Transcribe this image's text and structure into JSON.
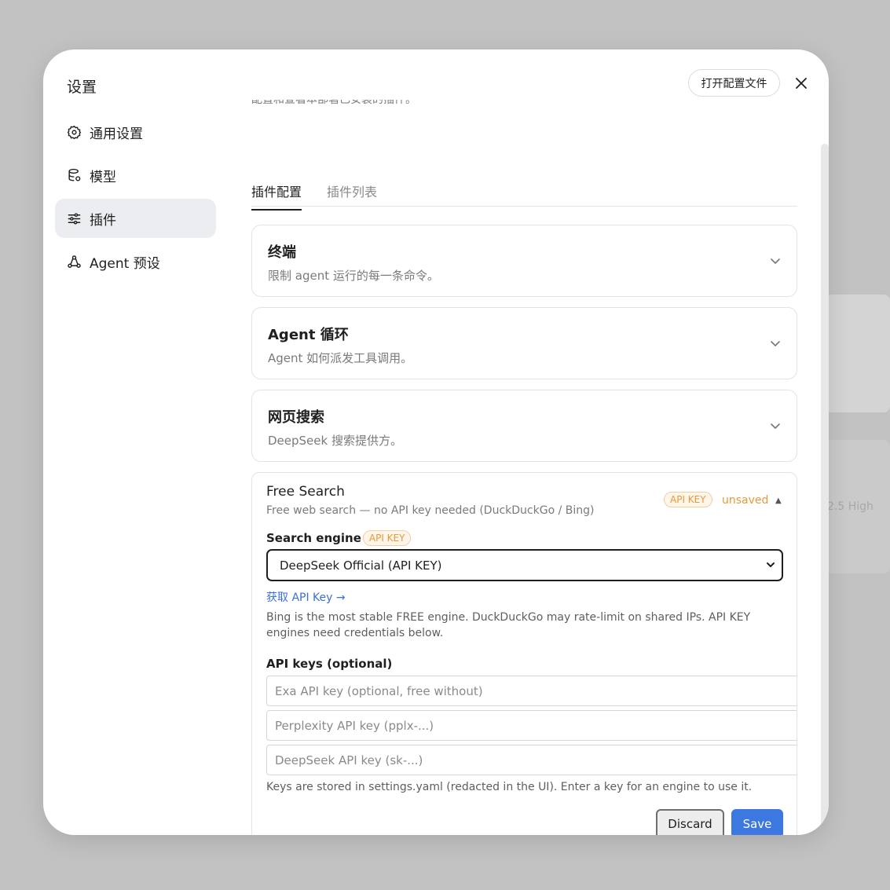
{
  "background": {
    "hint_text": "2.5 High"
  },
  "modal": {
    "title": "设置",
    "open_config_label": "打开配置文件",
    "close_icon": "close-icon"
  },
  "sidebar": {
    "items": [
      {
        "label": "通用设置",
        "icon": "gear-icon",
        "active": false
      },
      {
        "label": "模型",
        "icon": "database-icon",
        "active": false
      },
      {
        "label": "插件",
        "icon": "sliders-icon",
        "active": true
      },
      {
        "label": "Agent 预设",
        "icon": "agent-icon",
        "active": false
      }
    ]
  },
  "main": {
    "cut_off_text": "配置和查看本部署已安装的插件。",
    "tabs": [
      {
        "label": "插件配置",
        "active": true
      },
      {
        "label": "插件列表",
        "active": false
      }
    ],
    "sections": [
      {
        "title": "终端",
        "desc": "限制 agent 运行的每一条命令。"
      },
      {
        "title": "Agent 循环",
        "desc": "Agent 如何派发工具调用。"
      },
      {
        "title": "网页搜索",
        "desc": "DeepSeek 搜索提供方。"
      }
    ],
    "free_search": {
      "title": "Free Search",
      "desc": "Free web search — no API key needed (DuckDuckGo / Bing)",
      "badge": "API KEY",
      "status": "unsaved",
      "engine_label": "Search engine",
      "engine_badge": "API KEY",
      "engine_value": "DeepSeek Official (API KEY)",
      "get_key_link": "获取 API Key →",
      "help_text": "Bing is the most stable FREE engine. DuckDuckGo may rate-limit on shared IPs. API KEY engines need credentials below.",
      "keys_label": "API keys (optional)",
      "key_placeholders": [
        "Exa API key (optional, free without)",
        "Perplexity API key (pplx-...)",
        "DeepSeek API key (sk-...)"
      ],
      "keys_note": "Keys are stored in settings.yaml (redacted in the UI). Enter a key for an engine to use it.",
      "discard_label": "Discard",
      "save_label": "Save"
    }
  },
  "colors": {
    "accent": "#3c78e0",
    "warning": "#e59a3a",
    "active_nav": "#ebedf0"
  }
}
